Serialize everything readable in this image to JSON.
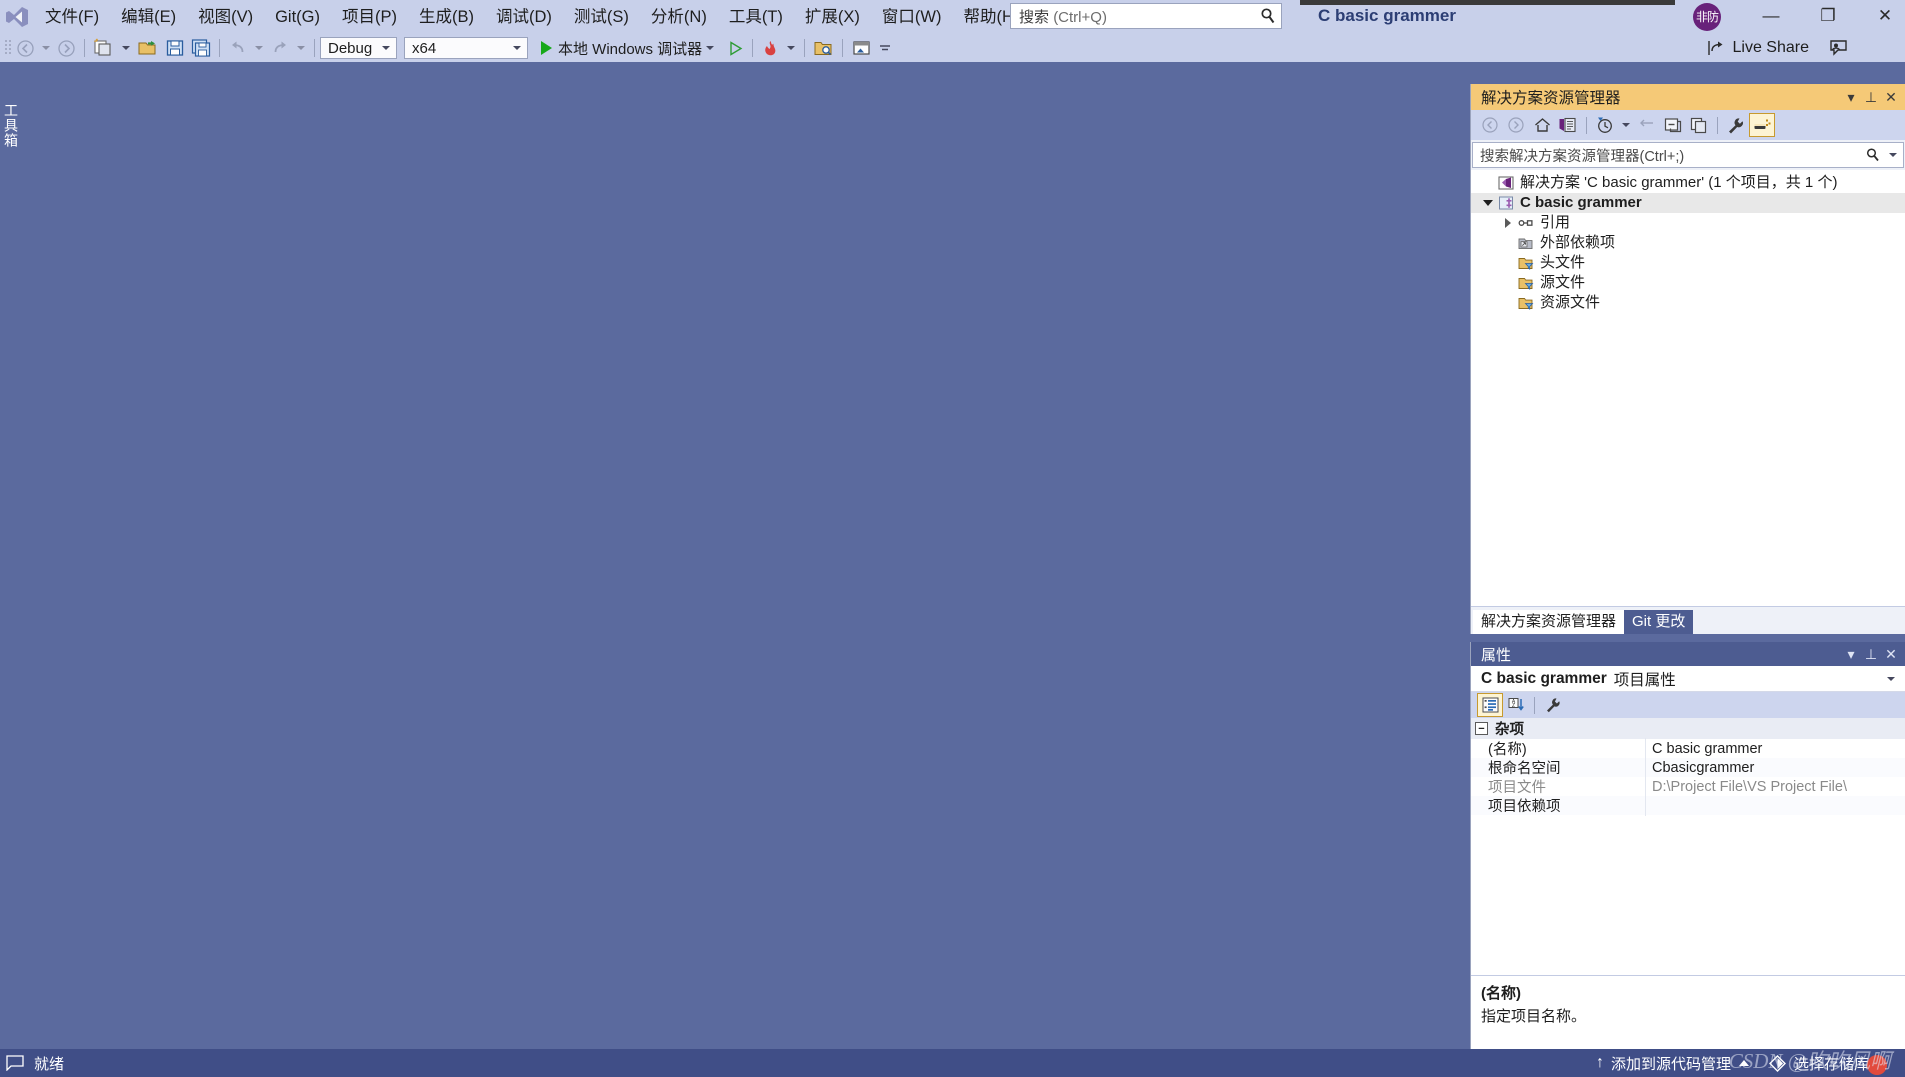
{
  "app": {
    "logo_icon": "visual-studio-logo",
    "project_title": "C basic grammer"
  },
  "menubar": {
    "items": [
      {
        "label": "文件(F)"
      },
      {
        "label": "编辑(E)"
      },
      {
        "label": "视图(V)"
      },
      {
        "label": "Git(G)"
      },
      {
        "label": "项目(P)"
      },
      {
        "label": "生成(B)"
      },
      {
        "label": "调试(D)"
      },
      {
        "label": "测试(S)"
      },
      {
        "label": "分析(N)"
      },
      {
        "label": "工具(T)"
      },
      {
        "label": "扩展(X)"
      },
      {
        "label": "窗口(W)"
      },
      {
        "label": "帮助(H)"
      }
    ]
  },
  "search": {
    "label": "搜索",
    "hint": "(Ctrl+Q)",
    "icon": "search-icon"
  },
  "account": {
    "avatar_initials": "非防",
    "avatar_color": "#68217a"
  },
  "window_controls": {
    "minimize": "—",
    "maximize": "❐",
    "close": "✕"
  },
  "toolbar": {
    "navigate_back_icon": "arrow-back-icon",
    "navigate_forward_icon": "arrow-forward-icon",
    "new_project_icon": "new-project-icon",
    "open_file_icon": "open-folder-icon",
    "save_icon": "save-icon",
    "save_all_icon": "save-all-icon",
    "undo_icon": "undo-icon",
    "redo_icon": "redo-icon",
    "configuration": "Debug",
    "platform": "x64",
    "run_label": "本地 Windows 调试器",
    "start_without_debug_icon": "play-outline-icon",
    "hot_reload_icon": "hot-reload-flame-icon",
    "solution_explorer_icon": "find-in-folder-icon",
    "window_layout_icon": "window-layout-icon",
    "overflow_icon": "toolbar-overflow-icon"
  },
  "liveshare": {
    "label": "Live Share",
    "icon": "live-share-icon",
    "feedback_icon": "send-feedback-icon"
  },
  "toolbox_tab": {
    "label": "工具箱"
  },
  "solution_explorer": {
    "title": "解决方案资源管理器",
    "title_buttons": {
      "dropdown": "▾",
      "pin": "⊥",
      "close": "✕"
    },
    "toolbar_icons": [
      "back-icon",
      "forward-icon",
      "home-icon",
      "sync-with-active-document-icon",
      "pending-changes-filter-icon",
      "refresh-icon",
      "collapse-all-icon",
      "show-all-files-icon",
      "properties-wrench-icon",
      "preview-selected-items-icon"
    ],
    "search_placeholder": "搜索解决方案资源管理器(Ctrl+;)",
    "tree": [
      {
        "label": "解决方案 'C basic grammer' (1 个项目，共 1 个)",
        "indent": 0,
        "icon": "solution-icon",
        "expander": "none",
        "bold": false,
        "selected": false
      },
      {
        "label": "C basic grammer",
        "indent": 1,
        "icon": "cpp-project-icon",
        "expander": "expanded",
        "bold": true,
        "selected": true
      },
      {
        "label": "引用",
        "indent": 2,
        "icon": "references-icon",
        "expander": "collapsed",
        "bold": false,
        "selected": false
      },
      {
        "label": "外部依赖项",
        "indent": 3,
        "icon": "external-dependencies-icon",
        "expander": "none",
        "bold": false,
        "selected": false
      },
      {
        "label": "头文件",
        "indent": 3,
        "icon": "filter-folder-icon",
        "expander": "none",
        "bold": false,
        "selected": false
      },
      {
        "label": "源文件",
        "indent": 3,
        "icon": "filter-folder-icon",
        "expander": "none",
        "bold": false,
        "selected": false
      },
      {
        "label": "资源文件",
        "indent": 3,
        "icon": "filter-folder-icon",
        "expander": "none",
        "bold": false,
        "selected": false
      }
    ],
    "tabs": [
      {
        "label": "解决方案资源管理器",
        "active": true
      },
      {
        "label": "Git 更改",
        "active": false
      }
    ]
  },
  "properties": {
    "title": "属性",
    "title_buttons": {
      "dropdown": "▾",
      "pin": "⊥",
      "close": "✕"
    },
    "object_name": "C basic grammer",
    "object_kind": "项目属性",
    "object_dropdown": "▾",
    "toolbar_icons": [
      "categorized-icon",
      "alphabetical-sort-icon",
      "property-pages-wrench-icon"
    ],
    "category": "杂项",
    "rows": [
      {
        "name": "(名称)",
        "value": "C basic grammer",
        "readonly": false
      },
      {
        "name": "根命名空间",
        "value": "Cbasicgrammer",
        "readonly": false
      },
      {
        "name": "项目文件",
        "value": "D:\\Project File\\VS Project File\\",
        "readonly": true
      },
      {
        "name": "项目依赖项",
        "value": "",
        "readonly": false
      }
    ],
    "description_title": "(名称)",
    "description_text": "指定项目名称。"
  },
  "statusbar": {
    "ready_label": "就绪",
    "ready_icon": "notification-icon",
    "source_control_label": "添加到源代码管理",
    "source_control_icon": "arrow-up-icon",
    "repository_label": "选择存储库",
    "repository_icon": "git-repository-icon",
    "watermark": "CSDN @吹吹风啊"
  },
  "colors": {
    "menubar_bg": "#c8d0ea",
    "editor_bg": "#5b6a9e",
    "panel_title_active": "#f5c977",
    "panel_title_inactive": "#4d5c91",
    "statusbar_bg": "#404e87",
    "accent_green": "#17a81a"
  }
}
